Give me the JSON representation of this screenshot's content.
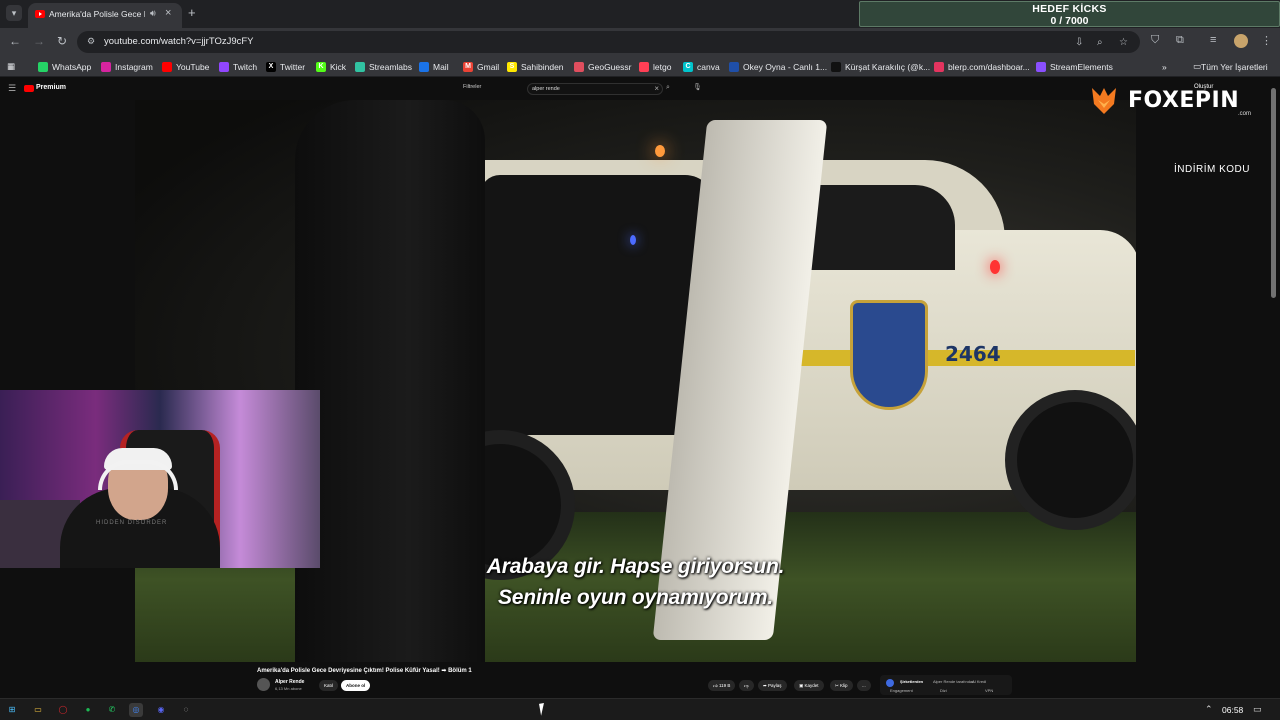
{
  "browser": {
    "tab": {
      "title": "Amerika'da Polisle Gece De",
      "audio_icon": "speaker-icon",
      "close": "×"
    },
    "new_tab": "+",
    "url": "youtube.com/watch?v=jjrTOzJ9cFY"
  },
  "goal_widget": {
    "title": "HEDEF KİCKS",
    "progress": "0 / 7000"
  },
  "bookmarks": [
    {
      "label": "WhatsApp",
      "icon": "whatsapp-icon",
      "color": "#25d366",
      "glyph": ""
    },
    {
      "label": "Instagram",
      "icon": "instagram-icon",
      "color": "#d6249f",
      "glyph": ""
    },
    {
      "label": "YouTube",
      "icon": "youtube-icon",
      "color": "#ff0000",
      "glyph": ""
    },
    {
      "label": "Twitch",
      "icon": "twitch-icon",
      "color": "#9146ff",
      "glyph": ""
    },
    {
      "label": "Twitter",
      "icon": "x-icon",
      "color": "#000000",
      "glyph": "X"
    },
    {
      "label": "Kick",
      "icon": "kick-icon",
      "color": "#53fc18",
      "glyph": "K"
    },
    {
      "label": "Streamlabs",
      "icon": "streamlabs-icon",
      "color": "#31c3a2",
      "glyph": ""
    },
    {
      "label": "Mail",
      "icon": "mail-icon",
      "color": "#1a73e8",
      "glyph": ""
    },
    {
      "label": "Gmail",
      "icon": "gmail-icon",
      "color": "#ea4335",
      "glyph": "M"
    },
    {
      "label": "Sahibinden",
      "icon": "sahibinden-icon",
      "color": "#ffe800",
      "glyph": "S"
    },
    {
      "label": "GeoGuessr",
      "icon": "geoguessr-icon",
      "color": "#e04e5e",
      "glyph": ""
    },
    {
      "label": "letgo",
      "icon": "letgo-icon",
      "color": "#ff3f55",
      "glyph": ""
    },
    {
      "label": "canva",
      "icon": "canva-icon",
      "color": "#00c4cc",
      "glyph": "C"
    },
    {
      "label": "Okey Oyna - Canlı 1...",
      "icon": "okey-icon",
      "color": "#1f4fa8",
      "glyph": ""
    },
    {
      "label": "Kürşat Karakılıç (@k...",
      "icon": "tiktok-icon",
      "color": "#111111",
      "glyph": ""
    },
    {
      "label": "blerp.com/dashboar...",
      "icon": "blerp-icon",
      "color": "#e4345f",
      "glyph": ""
    },
    {
      "label": "StreamElements",
      "icon": "streamelements-icon",
      "color": "#8a4fff",
      "glyph": ""
    }
  ],
  "bookmarks_overflow": "»",
  "all_bookmarks": "Tüm Yer İşaretleri",
  "youtube": {
    "premium_label": "Premium",
    "filter_label": "Filtreler",
    "search_query": "alper rende",
    "create_label": "Oluştur"
  },
  "video": {
    "subtitle_line1": "Arabaya gir. Hapse giriyorsun.",
    "subtitle_line2": "Seninle oyun oynamıyorum.",
    "car_number": "2464",
    "title": "Amerika'da Polisle Gece Devriyesine Çıktım! Polise Küfür Yasal! ➡ Bölüm 1",
    "channel_name": "Alper Rende",
    "channel_subs": "6,13 Mn abone",
    "join_label": "Katıl",
    "subscribe_label": "Abone ol",
    "like_count": "119 B",
    "share_label": "Paylaş",
    "save_label": "Kaydet",
    "clip_label": "Klip",
    "more_label": "..."
  },
  "sidebar_chips": [
    {
      "label": "Şirketlerden"
    },
    {
      "label": "Alper Rende tarafından"
    },
    {
      "label": "AI Kredi"
    }
  ],
  "sidebar_sub_labels": [
    "Engagement",
    "Dizi",
    "VPN"
  ],
  "overlay": {
    "brand": "FOXEPIN",
    "brand_domain": ".com",
    "discount_text": "İNDİRİM KODU"
  },
  "webcam": {
    "shirt_text": "HIDDEN DISORDER"
  },
  "taskbar": {
    "time": "06:58"
  }
}
